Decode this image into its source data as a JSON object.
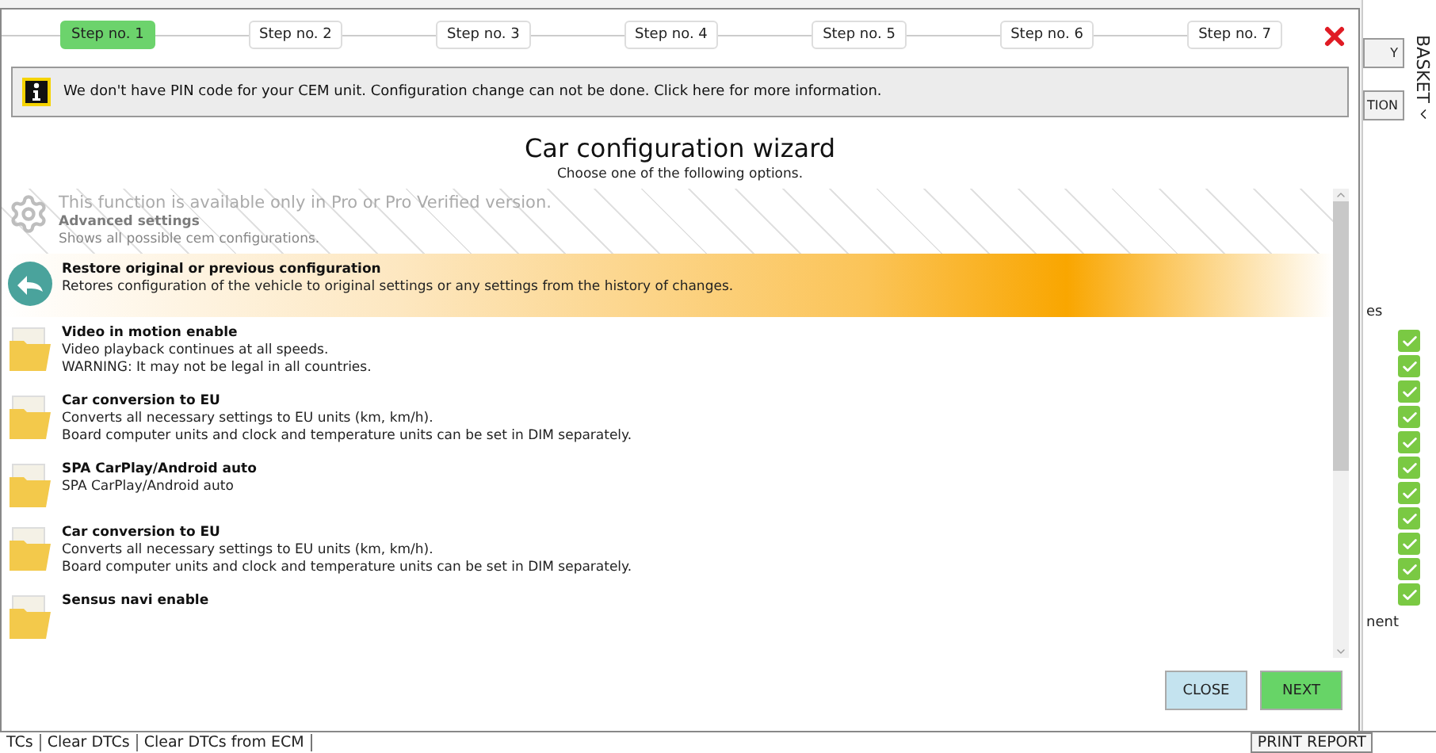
{
  "wizard": {
    "steps": [
      {
        "label": "Step no. 1",
        "selected": true
      },
      {
        "label": "Step no. 2",
        "selected": false
      },
      {
        "label": "Step no. 3",
        "selected": false
      },
      {
        "label": "Step no. 4",
        "selected": false
      },
      {
        "label": "Step no. 5",
        "selected": false
      },
      {
        "label": "Step no. 6",
        "selected": false
      },
      {
        "label": "Step no. 7",
        "selected": false
      }
    ],
    "notice": "We don't have PIN code for your CEM unit. Configuration change can not be done. Click here for more information.",
    "title": "Car configuration wizard",
    "subtitle": "Choose one of the following options.",
    "options": [
      {
        "kind": "locked",
        "banner": "This function is available only in Pro or Pro Verified version.",
        "title": "Advanced settings",
        "lines": [
          "Shows all possible cem configurations."
        ],
        "highlighted": false
      },
      {
        "kind": "restore",
        "title": "Restore original or previous configuration",
        "lines": [
          "Retores configuration of the vehicle to original settings or any settings from the history of changes."
        ],
        "highlighted": true
      },
      {
        "kind": "folder",
        "title": "Video in motion enable",
        "lines": [
          "Video playback continues at all speeds.",
          "WARNING: It may not be legal in all countries."
        ],
        "highlighted": false
      },
      {
        "kind": "folder",
        "title": "Car conversion to EU",
        "lines": [
          "Converts all necessary settings to EU units (km, km/h).",
          "Board computer units and clock and temperature units can be set in DIM separately."
        ],
        "highlighted": false
      },
      {
        "kind": "folder",
        "title": "SPA CarPlay/Android auto",
        "lines": [
          "SPA CarPlay/Android auto"
        ],
        "highlighted": false
      },
      {
        "kind": "folder",
        "title": "Car conversion to EU",
        "lines": [
          "Converts all necessary settings to EU units (km, km/h).",
          "Board computer units and clock and temperature units can be set in DIM separately."
        ],
        "highlighted": false
      },
      {
        "kind": "folder",
        "title": "Sensus navi enable",
        "highlighted": false
      }
    ],
    "buttons": [
      {
        "label": "CLOSE",
        "kind": "secondary"
      },
      {
        "label": "NEXT",
        "kind": "primary"
      }
    ]
  },
  "side_panel": {
    "buttons": [
      "Y",
      "TION"
    ],
    "basket": "BASKET",
    "labels": [
      "es",
      "nent"
    ]
  },
  "status_bar": {
    "tabs": [
      "TCs",
      "Clear DTCs",
      "Clear DTCs from ECM"
    ],
    "print": "PRINT REPORT"
  }
}
